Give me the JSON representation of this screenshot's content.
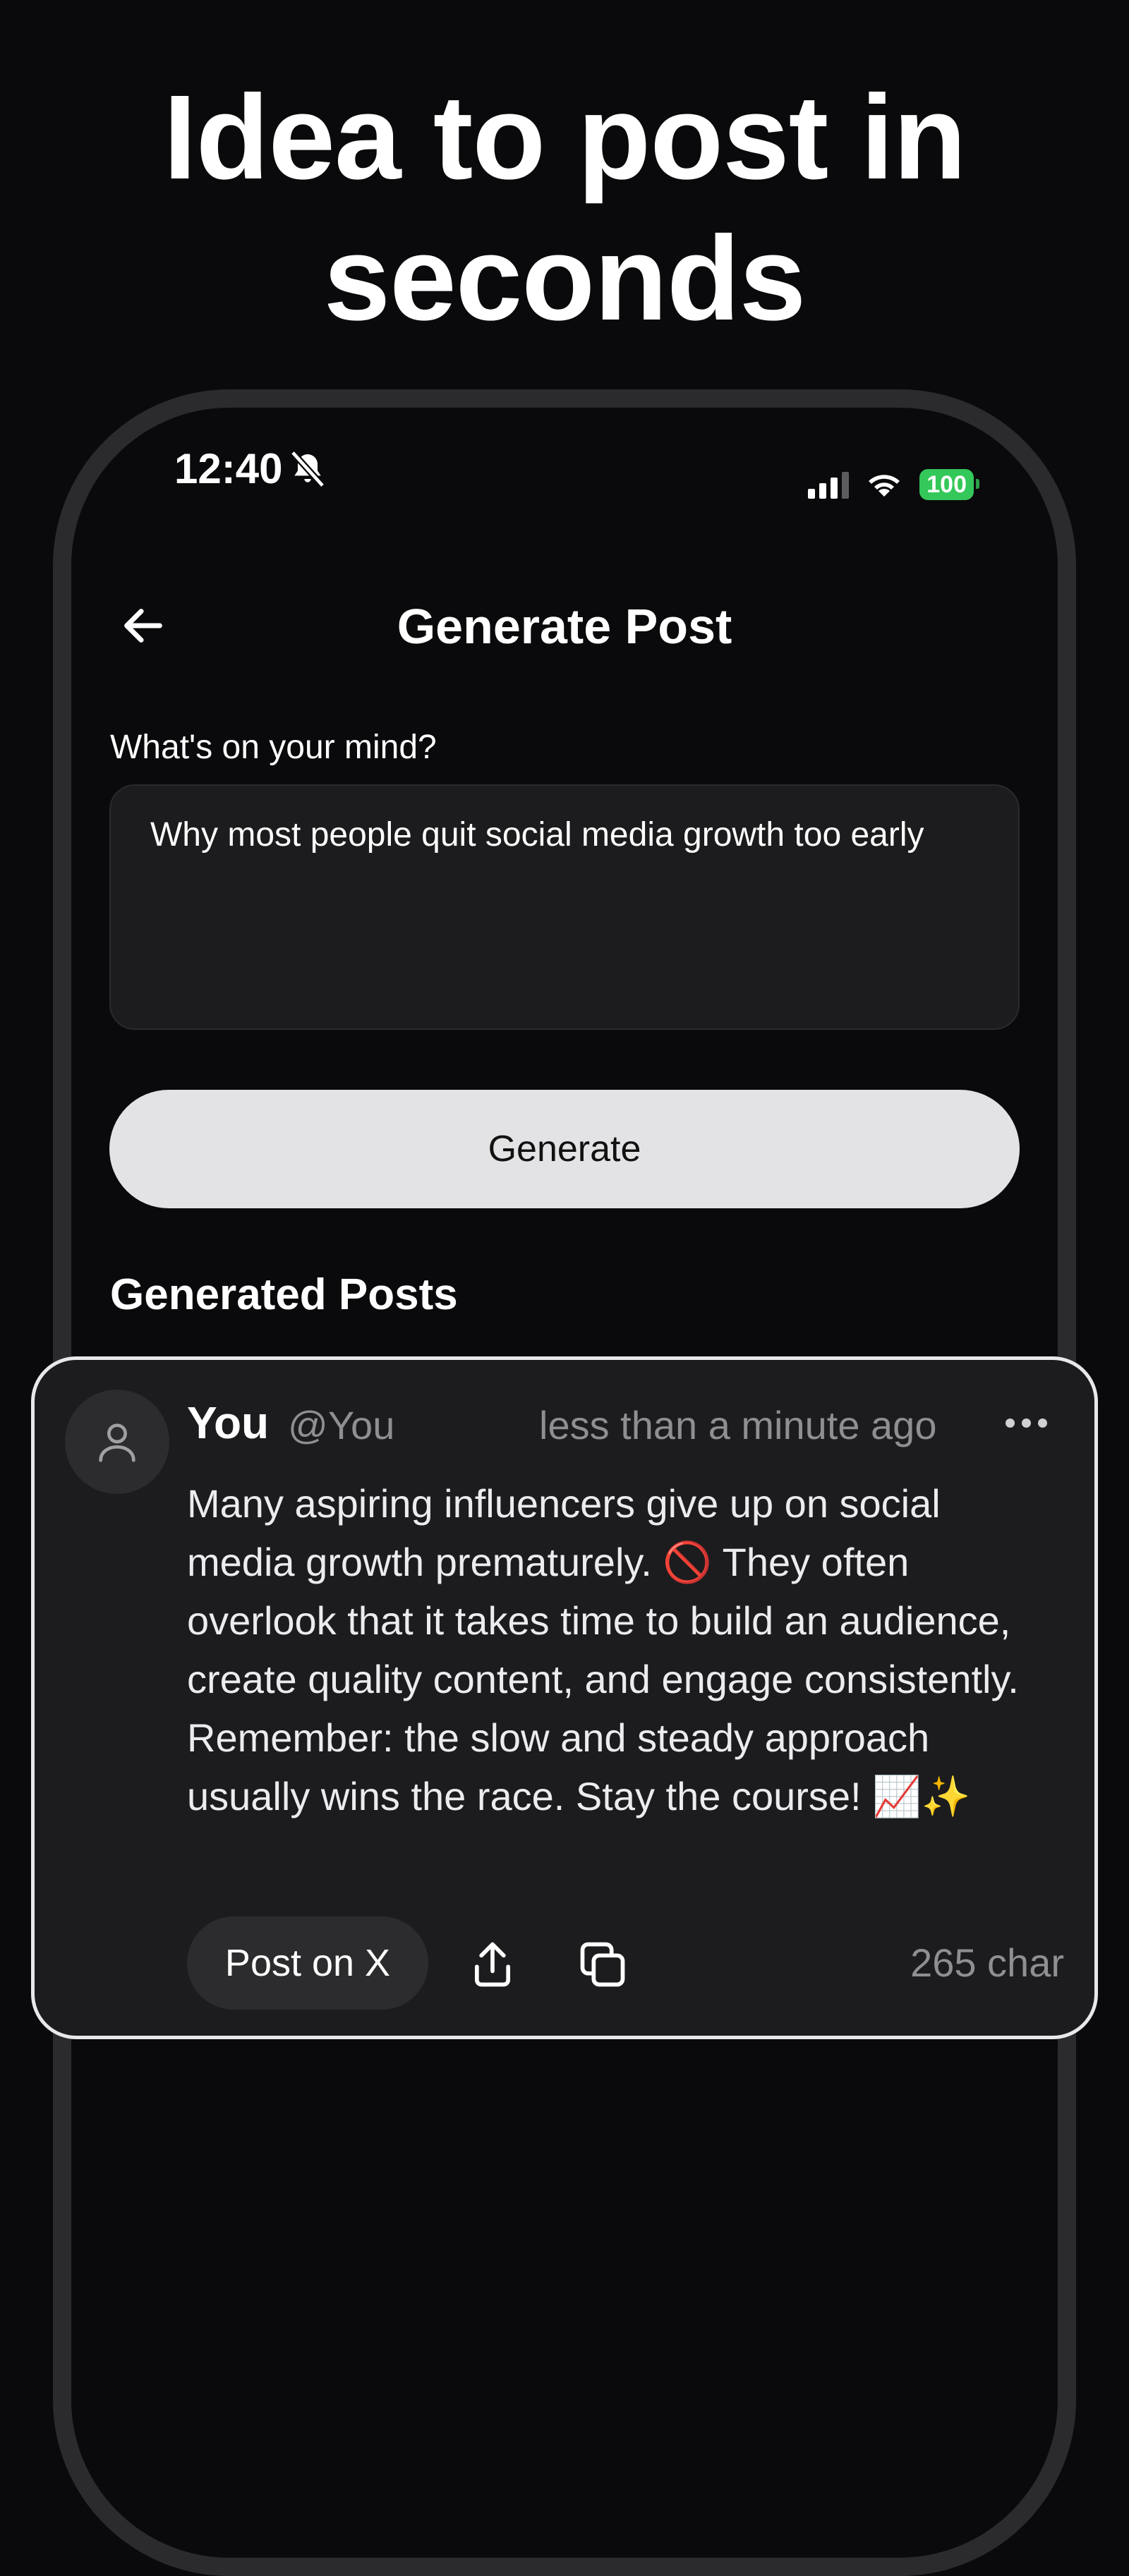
{
  "headline": {
    "line1": "Idea to post in",
    "line2": "seconds"
  },
  "status_bar": {
    "time": "12:40",
    "battery": "100",
    "icons": [
      "bell-slash-icon",
      "signal-icon",
      "wifi-icon",
      "battery-icon"
    ]
  },
  "header": {
    "title": "Generate Post",
    "back_icon": "arrow-left-icon"
  },
  "form": {
    "label": "What's on your mind?",
    "input_value": "Why most people quit social media growth too early",
    "generate_label": "Generate"
  },
  "generated": {
    "section_title": "Generated Posts",
    "posts": [
      {
        "name": "You",
        "handle": "@You",
        "time": "less than a minute ago",
        "body": "Many aspiring influencers give up on social media growth prematurely. 🚫 They often overlook that it takes time to build an audience, create quality content, and engage consistently. Remember: the slow and steady approach usually wins the race. Stay the course! 📈✨",
        "post_button": "Post on X",
        "char_count": "265 char"
      }
    ]
  },
  "colors": {
    "background": "#0a0a0c",
    "card": "#1c1c1e",
    "button": "#e3e3e5",
    "muted": "#8e8e93",
    "battery": "#34c759"
  }
}
